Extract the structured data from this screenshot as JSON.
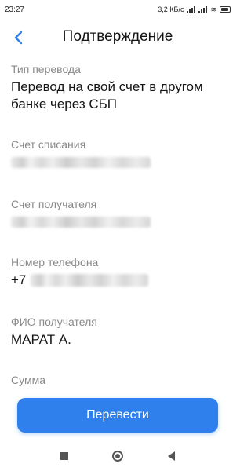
{
  "status_bar": {
    "time": "23:27",
    "net_speed": "3,2 КБ/с"
  },
  "header": {
    "title": "Подтверждение",
    "back_icon": "chevron-left-icon"
  },
  "fields": [
    {
      "label": "Тип перевода",
      "value": "Перевод на свой счет в другом банке через СБП"
    },
    {
      "label": "Счет списания",
      "value": ""
    },
    {
      "label": "Счет получателя",
      "value": ""
    },
    {
      "label": "Номер телефона",
      "value": "+7"
    },
    {
      "label": "ФИО получателя",
      "value": "МАРАТ А."
    },
    {
      "label": "Сумма",
      "value": ""
    }
  ],
  "actions": {
    "submit_label": "Перевести"
  },
  "colors": {
    "accent": "#2f80ed",
    "label": "#8a8a8a",
    "text": "#141414"
  }
}
